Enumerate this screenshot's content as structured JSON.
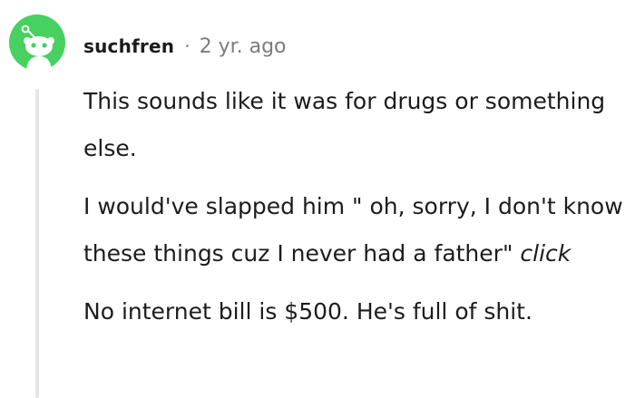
{
  "comment": {
    "username": "suchfren",
    "separator": "·",
    "timestamp": "2 yr. ago",
    "avatar_icon": "reddit-snoo-avatar-icon",
    "avatar_color": "#46d160",
    "paragraphs": [
      {
        "text": "This sounds like it was for drugs or something else."
      },
      {
        "text": "I would've slapped him \" oh, sorry, I don't know these things cuz I never had a father\"",
        "emphasis": "click"
      },
      {
        "text": "No internet bill is $500. He's full of shit."
      }
    ]
  }
}
